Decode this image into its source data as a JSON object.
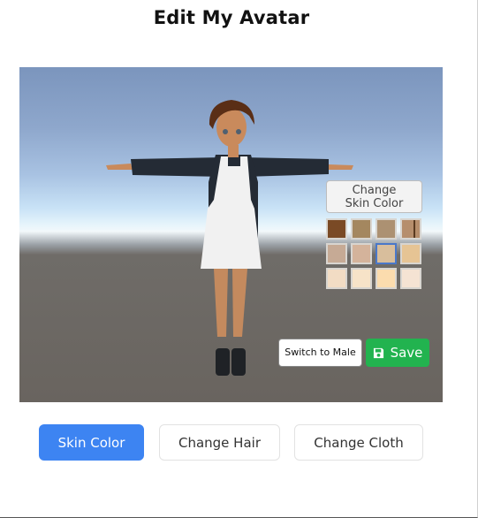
{
  "page": {
    "title": "Edit My Avatar"
  },
  "viewport": {
    "scene": "3D avatar preview",
    "avatar_description": "Female avatar in T-pose, short brown hair, dark hoodie with white apron dress, black sneakers",
    "skin_panel": {
      "button_label_line1": "Change",
      "button_label_line2": "Skin Color",
      "swatches": [
        {
          "color": "#7a4a25",
          "selected": false
        },
        {
          "color": "#a4875f",
          "selected": false
        },
        {
          "color": "#ac9172",
          "selected": false
        },
        {
          "color": "#b68e6c",
          "selected": false
        },
        {
          "color": "#c6aa95",
          "selected": false
        },
        {
          "color": "#d4b39b",
          "selected": false
        },
        {
          "color": "#d8be9c",
          "selected": true
        },
        {
          "color": "#e6c494",
          "selected": false
        },
        {
          "color": "#f2dcc4",
          "selected": false
        },
        {
          "color": "#f7e3c8",
          "selected": false
        },
        {
          "color": "#fbdcae",
          "selected": false
        },
        {
          "color": "#f5e3d3",
          "selected": false
        }
      ]
    },
    "switch_button_label": "Switch to Male",
    "save_button": {
      "label": "Save",
      "icon": "floppy-disk-icon"
    }
  },
  "tabs": [
    {
      "label": "Skin Color",
      "active": true
    },
    {
      "label": "Change Hair",
      "active": false
    },
    {
      "label": "Change Cloth",
      "active": false
    }
  ],
  "colors": {
    "accent_blue": "#3d84f2",
    "save_green": "#22b34f",
    "selected_swatch_border": "#4a78c9"
  }
}
